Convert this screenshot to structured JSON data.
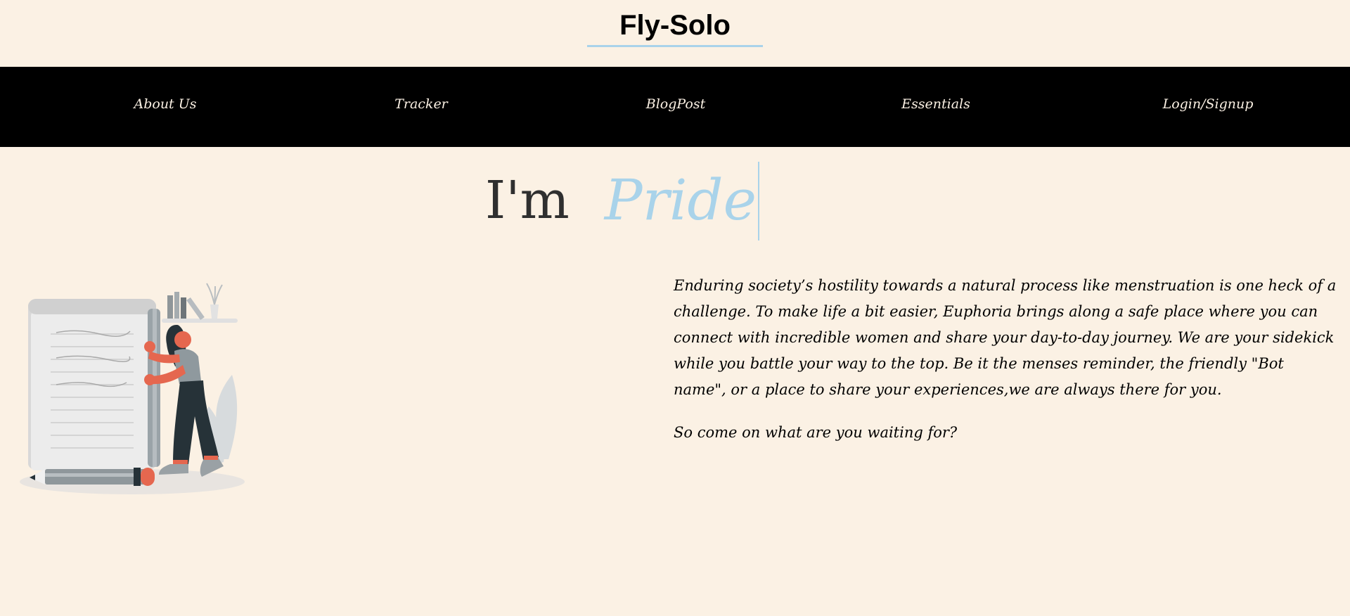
{
  "site": {
    "title": "Fly-Solo",
    "accent_color": "#a9d3ea",
    "background_color": "#fbf1e4",
    "navbar_color": "#000000"
  },
  "nav": {
    "items": [
      {
        "label": "About Us"
      },
      {
        "label": "Tracker"
      },
      {
        "label": "BlogPost"
      },
      {
        "label": "Essentials"
      },
      {
        "label": "Login/Signup"
      }
    ]
  },
  "hero": {
    "prefix": "I'm",
    "typed_word": "Pride"
  },
  "intro": {
    "paragraph": "Enduring society’s hostility towards a natural process like menstruation is one heck of a challenge. To make life a bit easier, Euphoria brings along a safe place where you can connect with incredible women and share your day-to-day journey. We are your sidekick while you battle your way to the top. Be it the menses reminder, the friendly \"Bot name\", or a place to share your experiences,we are always there for you.",
    "call_to_action": "So come on what are you waiting for?"
  },
  "illustration": {
    "icon": "woman-with-notepad-illustration"
  }
}
